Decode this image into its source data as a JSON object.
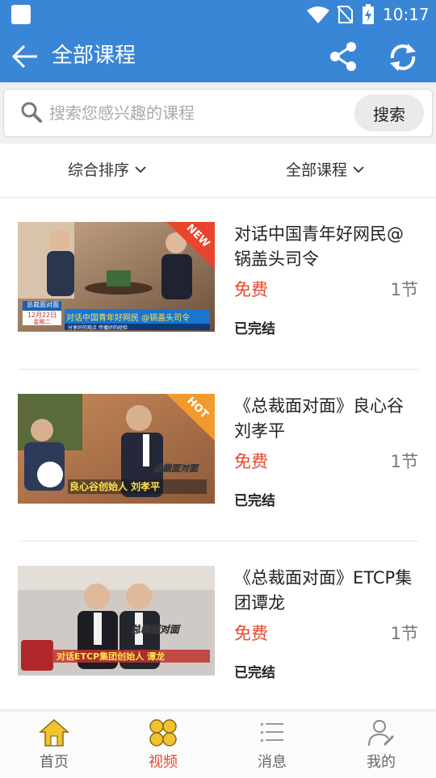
{
  "status_bar": {
    "time": "10:17"
  },
  "app_bar": {
    "title": "全部课程"
  },
  "search": {
    "placeholder": "搜索您感兴趣的课程",
    "button_label": "搜索"
  },
  "filters": {
    "sort_label": "综合排序",
    "category_label": "全部课程"
  },
  "courses": [
    {
      "title": "对话中国青年好网民@锅盖头司令",
      "price": "免费",
      "lessons": "1节",
      "status": "已完结",
      "badge": "NEW",
      "thumb_caption": "对话中国青年好网民 @锅盖头司令",
      "thumb_side": "总裁面对面",
      "thumb_date": "12月22日",
      "thumb_weekday": "星期二",
      "thumb_footer": "分享好的观点 传播好的经验"
    },
    {
      "title": "《总裁面对面》良心谷刘孝平",
      "price": "免费",
      "lessons": "1节",
      "status": "已完结",
      "badge": "HOT",
      "thumb_caption": "良心谷创始人 刘孝平",
      "thumb_side": "总裁面对面"
    },
    {
      "title": "《总裁面对面》ETCP集团谭龙",
      "price": "免费",
      "lessons": "1节",
      "status": "已完结",
      "thumb_caption": "对话ETCP集团创始人 谭龙",
      "thumb_side": "总裁面对面"
    }
  ],
  "bottom_nav": {
    "home": "首页",
    "video": "视频",
    "messages": "消息",
    "me": "我的"
  },
  "colors": {
    "primary": "#3a86d6",
    "accent": "#e8452c",
    "nav_active_icon": "#f2c230"
  }
}
